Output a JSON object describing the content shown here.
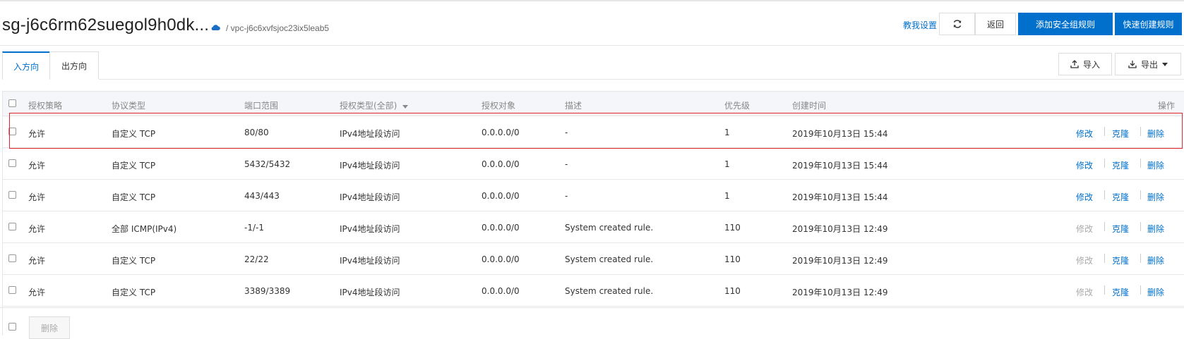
{
  "header": {
    "title": "sg-j6c6rm62suegol9h0dk...",
    "vpc": "/ vpc-j6c6xvfsjoc23ix5leab5",
    "tutorial_link": "教我设置",
    "back_label": "返回",
    "add_rule_label": "添加安全组规则",
    "quick_create_label": "快速创建规则",
    "accent": "#0070cc"
  },
  "tabs": {
    "inbound": "入方向",
    "outbound": "出方向"
  },
  "toolbar": {
    "import_label": "导入",
    "export_label": "导出"
  },
  "table": {
    "columns": {
      "policy": "授权策略",
      "protocol": "协议类型",
      "port": "端口范围",
      "auth_type": "授权类型(全部)",
      "auth_object": "授权对象",
      "description": "描述",
      "priority": "优先级",
      "created": "创建时间",
      "actions": "操作"
    },
    "actions": {
      "edit": "修改",
      "clone": "克隆",
      "delete": "删除"
    },
    "rows": [
      {
        "policy": "允许",
        "protocol": "自定义 TCP",
        "port": "80/80",
        "auth_type": "IPv4地址段访问",
        "auth_object": "0.0.0.0/0",
        "description": "-",
        "priority": "1",
        "created": "2019年10月13日 15:44",
        "edit_enabled": true
      },
      {
        "policy": "允许",
        "protocol": "自定义 TCP",
        "port": "5432/5432",
        "auth_type": "IPv4地址段访问",
        "auth_object": "0.0.0.0/0",
        "description": "-",
        "priority": "1",
        "created": "2019年10月13日 15:44",
        "edit_enabled": true
      },
      {
        "policy": "允许",
        "protocol": "自定义 TCP",
        "port": "443/443",
        "auth_type": "IPv4地址段访问",
        "auth_object": "0.0.0.0/0",
        "description": "-",
        "priority": "1",
        "created": "2019年10月13日 15:44",
        "edit_enabled": true
      },
      {
        "policy": "允许",
        "protocol": "全部 ICMP(IPv4)",
        "port": "-1/-1",
        "auth_type": "IPv4地址段访问",
        "auth_object": "0.0.0.0/0",
        "description": "System created rule.",
        "priority": "110",
        "created": "2019年10月13日 12:49",
        "edit_enabled": false
      },
      {
        "policy": "允许",
        "protocol": "自定义 TCP",
        "port": "22/22",
        "auth_type": "IPv4地址段访问",
        "auth_object": "0.0.0.0/0",
        "description": "System created rule.",
        "priority": "110",
        "created": "2019年10月13日 12:49",
        "edit_enabled": false
      },
      {
        "policy": "允许",
        "protocol": "自定义 TCP",
        "port": "3389/3389",
        "auth_type": "IPv4地址段访问",
        "auth_object": "0.0.0.0/0",
        "description": "System created rule.",
        "priority": "110",
        "created": "2019年10月13日 12:49",
        "edit_enabled": false
      }
    ]
  },
  "footer": {
    "delete_label": "删除"
  }
}
